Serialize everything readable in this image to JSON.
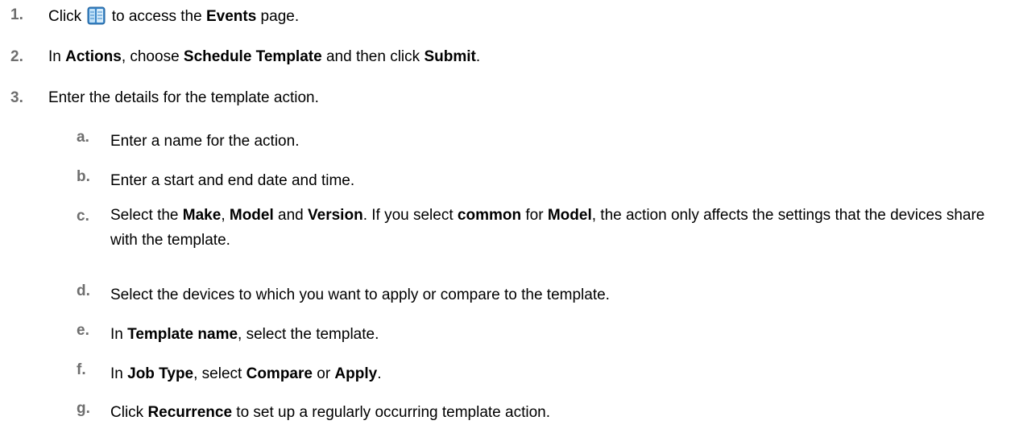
{
  "steps": [
    {
      "num": "1.",
      "parts": [
        "Click ",
        " to access the ",
        "Events",
        " page."
      ]
    },
    {
      "num": "2.",
      "parts": [
        "In ",
        "Actions",
        ", choose ",
        "Schedule Template",
        " and then click ",
        "Submit",
        "."
      ]
    },
    {
      "num": "3.",
      "parts": [
        "Enter the details for the template action."
      ]
    }
  ],
  "substeps": [
    {
      "num": "a.",
      "parts": [
        "Enter a name for the action."
      ]
    },
    {
      "num": "b.",
      "parts": [
        "Enter a start and end date and time."
      ]
    },
    {
      "num": "c.",
      "parts": [
        "Select the ",
        "Make",
        ", ",
        "Model",
        " and ",
        "Version",
        ". If you select ",
        "common",
        " for ",
        "Model",
        ", the action only affects the settings that the devices share with the template."
      ]
    },
    {
      "num": "d.",
      "parts": [
        "Select the devices to which you want to apply or compare to the template."
      ]
    },
    {
      "num": "e.",
      "parts": [
        "In ",
        "Template name",
        ", select the template."
      ]
    },
    {
      "num": "f.",
      "parts": [
        "In ",
        "Job Type",
        ", select ",
        "Compare",
        " or ",
        "Apply",
        "."
      ]
    },
    {
      "num": "g.",
      "parts": [
        "Click ",
        "Recurrence",
        " to set up a regularly occurring template action."
      ]
    }
  ],
  "icons": {
    "events": "events-calendar-icon"
  },
  "colors": {
    "step_number": "#6e6e6e",
    "text": "#000000",
    "icon_blue": "#3a86c8"
  }
}
